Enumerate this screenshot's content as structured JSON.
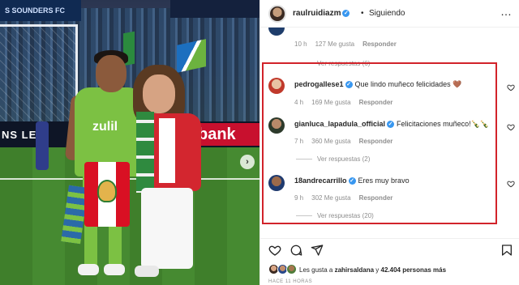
{
  "photo": {
    "top_board_text": "S SOUNDERS FC",
    "adboard_text": "NS LEA",
    "bank_text": "bank",
    "jersey_text": "zulil",
    "next_icon": "chevron-right-icon"
  },
  "header": {
    "username": "raulruidiazm",
    "verified_mark": "✓",
    "separator": "•",
    "follow_label": "Siguiendo",
    "more_label": "…"
  },
  "previous_comment": {
    "time": "10 h",
    "likes": "127 Me gusta",
    "reply_label": "Responder",
    "view_replies": "Ver respuestas (6)"
  },
  "comments": [
    {
      "username": "pedrogallese1",
      "text": "Que lindo muñeco felicidades 🤎",
      "time": "4 h",
      "likes": "169 Me gusta",
      "reply_label": "Responder",
      "view_replies": ""
    },
    {
      "username": "gianluca_lapadula_official",
      "text": "Felicitaciones muñeco!🍾🍾",
      "time": "7 h",
      "likes": "360 Me gusta",
      "reply_label": "Responder",
      "view_replies": "Ver respuestas (2)"
    },
    {
      "username": "18andrecarrillo",
      "text": "Eres muy bravo",
      "time": "9 h",
      "likes": "302 Me gusta",
      "reply_label": "Responder",
      "view_replies": "Ver respuestas (20)"
    }
  ],
  "likes_summary": {
    "prefix": "Les gusta a ",
    "user": "zahirsaldana",
    "middle": " y ",
    "count": "42.404 personas más"
  },
  "timestamp": "HACE 11 HORAS",
  "colors": {
    "highlight": "#d2232a",
    "verified": "#3897f0",
    "meta_gray": "#8e8e8e",
    "text": "#262626"
  },
  "icons": {
    "like": "heart-icon",
    "comment": "comment-icon",
    "share": "share-icon",
    "save": "bookmark-icon"
  }
}
